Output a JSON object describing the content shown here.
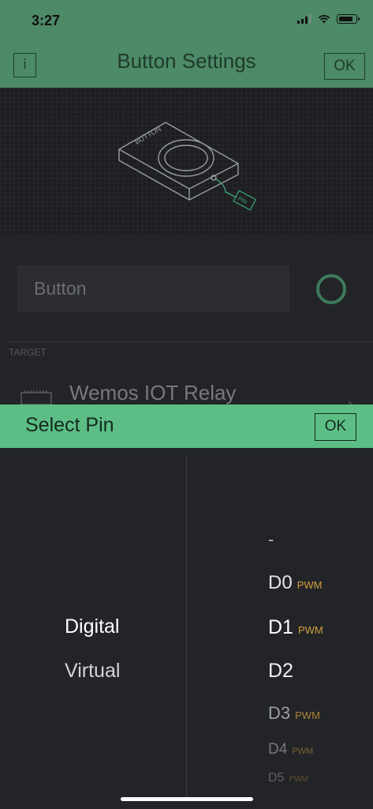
{
  "status_bar": {
    "time": "3:27"
  },
  "header": {
    "info_label": "i",
    "title": "Button Settings",
    "ok_label": "OK"
  },
  "preview": {
    "device_label": "BUTTON",
    "pin_label": "PIN"
  },
  "settings": {
    "name_value": "Button",
    "target_label": "TARGET",
    "device_name": "Wemos IOT Relay",
    "chevron": "›"
  },
  "sheet": {
    "title": "Select Pin",
    "ok_label": "OK",
    "pin_types": [
      "Digital",
      "Virtual"
    ],
    "pins": [
      {
        "label": "-",
        "badge": ""
      },
      {
        "label": "D0",
        "badge": "PWM"
      },
      {
        "label": "D1",
        "badge": "PWM"
      },
      {
        "label": "D2",
        "badge": ""
      },
      {
        "label": "D3",
        "badge": "PWM"
      },
      {
        "label": "D4",
        "badge": "PWM"
      },
      {
        "label": "D5",
        "badge": "PWM"
      }
    ]
  },
  "colors": {
    "header": "#4d8a67",
    "sheet_header": "#5cbe85",
    "pwm_badge": "#d4a03a"
  }
}
